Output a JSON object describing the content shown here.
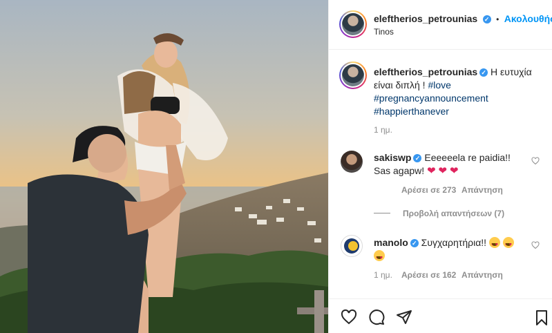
{
  "header": {
    "username": "eleftherios_petrounias",
    "follow_sep": "•",
    "follow_label": "Ακολουθήστ",
    "location": "Tinos"
  },
  "caption": {
    "username": "eleftherios_petrounias",
    "text": "Η ευτυχία είναι διπλή !",
    "hashtags": [
      "#love",
      "#pregnancyannouncement",
      "#happierthanever"
    ],
    "time": "1 ημ."
  },
  "comments": [
    {
      "username": "sakiswp",
      "text_line1": "Eeeeeela re paidia!!",
      "text_line2": "Sas agapw!",
      "likes_label": "Αρέσει σε 273",
      "reply_label": "Απάντηση",
      "view_replies": "Προβολή απαντήσεων (7)"
    },
    {
      "username": "manolo",
      "text": "Συγχαρητήρια!!",
      "time": "1 ημ.",
      "likes_label": "Αρέσει σε 162",
      "reply_label": "Απάντηση"
    }
  ],
  "colors": {
    "link_blue": "#0095f6",
    "hashtag": "#00376b",
    "verified": "#3897f0"
  },
  "icons": {
    "like": "heart-icon",
    "comment": "comment-icon",
    "share": "paper-plane-icon",
    "save": "bookmark-icon",
    "verified": "verified-badge-icon"
  }
}
